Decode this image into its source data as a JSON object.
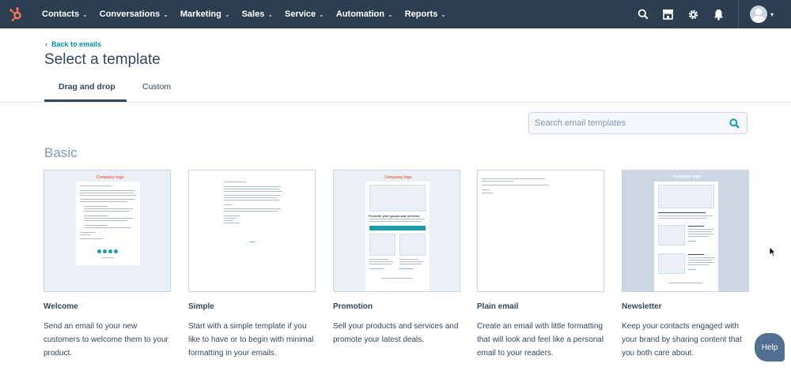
{
  "nav": {
    "items": [
      "Contacts",
      "Conversations",
      "Marketing",
      "Sales",
      "Service",
      "Automation",
      "Reports"
    ],
    "icons": [
      "search-icon",
      "marketplace-icon",
      "settings-icon",
      "notifications-icon"
    ]
  },
  "header": {
    "back_label": "Back to emails",
    "title": "Select a template"
  },
  "tabs": [
    {
      "label": "Drag and drop",
      "active": true
    },
    {
      "label": "Custom",
      "active": false
    }
  ],
  "search": {
    "placeholder": "Search email templates"
  },
  "section": {
    "title": "Basic"
  },
  "templates": [
    {
      "name": "Welcome",
      "description": "Send an email to your new customers to welcome them to your product.",
      "thumb_logo": "Company logo"
    },
    {
      "name": "Simple",
      "description": "Start with a simple template if you like to have or to begin with minimal formatting in your emails."
    },
    {
      "name": "Promotion",
      "description": "Sell your products and services and promote your latest deals.",
      "thumb_logo": "Company logo",
      "thumb_heading": "Promote your goods and services"
    },
    {
      "name": "Plain email",
      "description": "Create an email with little formatting that will look and feel like a personal email to your readers."
    },
    {
      "name": "Newsletter",
      "description": "Keep your contacts engaged with your brand by sharing content that you both care about.",
      "thumb_logo": "Company logo"
    }
  ],
  "help": {
    "label": "Help"
  },
  "colors": {
    "nav_bg": "#2d3e50",
    "link": "#0091ae",
    "accent": "#ff7a59",
    "teal": "#1a9bae"
  }
}
